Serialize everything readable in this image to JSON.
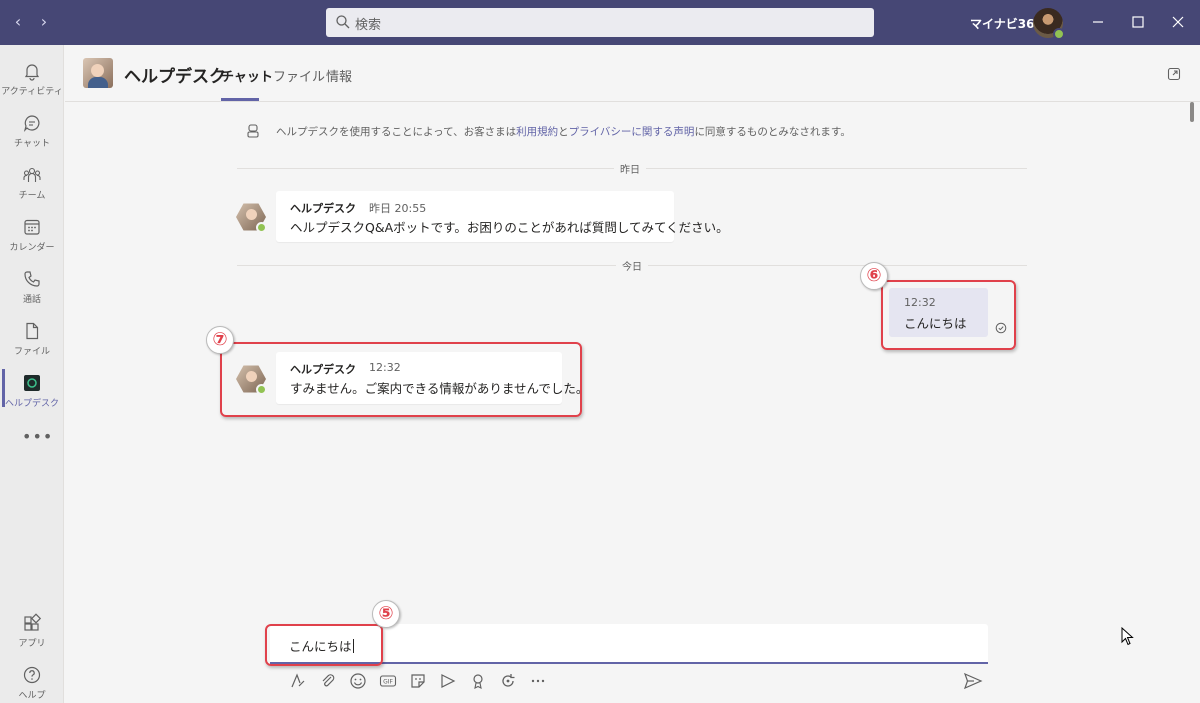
{
  "titlebar": {
    "search_placeholder": "検索",
    "org_name": "マイナビ365",
    "back_glyph": "‹",
    "forward_glyph": "›"
  },
  "rail": {
    "items": [
      {
        "label": "アクティビティ",
        "icon": "bell-icon"
      },
      {
        "label": "チャット",
        "icon": "chat-icon"
      },
      {
        "label": "チーム",
        "icon": "teams-icon"
      },
      {
        "label": "カレンダー",
        "icon": "calendar-icon"
      },
      {
        "label": "通話",
        "icon": "phone-icon"
      },
      {
        "label": "ファイル",
        "icon": "file-icon"
      },
      {
        "label": "ヘルプデスク",
        "icon": "helpdesk-app-icon"
      }
    ],
    "more": "•••",
    "bottom_items": [
      {
        "label": "アプリ",
        "icon": "apps-icon"
      },
      {
        "label": "ヘルプ",
        "icon": "help-icon"
      }
    ]
  },
  "header": {
    "title": "ヘルプデスク",
    "tabs": [
      "チャット",
      "ファイル",
      "情報"
    ],
    "active_tab": "チャット"
  },
  "chat": {
    "terms": {
      "prefix": "ヘルプデスクを使用することによって、お客さまは",
      "link1": "利用規約",
      "mid": "と",
      "link2": "プライバシーに関する声明",
      "suffix": "に同意するものとみなされます。"
    },
    "date_yesterday": "昨日",
    "date_today": "今日",
    "messages": [
      {
        "sender": "ヘルプデスク",
        "time": "昨日 20:55",
        "text": "ヘルプデスクQ&Aボットです。お困りのことがあれば質問してみてください。"
      },
      {
        "time": "12:32",
        "text": "こんにちは",
        "mine": true
      },
      {
        "sender": "ヘルプデスク",
        "time": "12:32",
        "text": "すみません。ご案内できる情報がありませんでした。"
      }
    ]
  },
  "callouts": {
    "five": "⑤",
    "six": "⑥",
    "seven": "⑦"
  },
  "compose": {
    "value": "こんにちは"
  },
  "colors": {
    "titlebar": "#464775",
    "accent": "#6264a7",
    "callout": "#e0414b",
    "presence": "#92c353"
  }
}
